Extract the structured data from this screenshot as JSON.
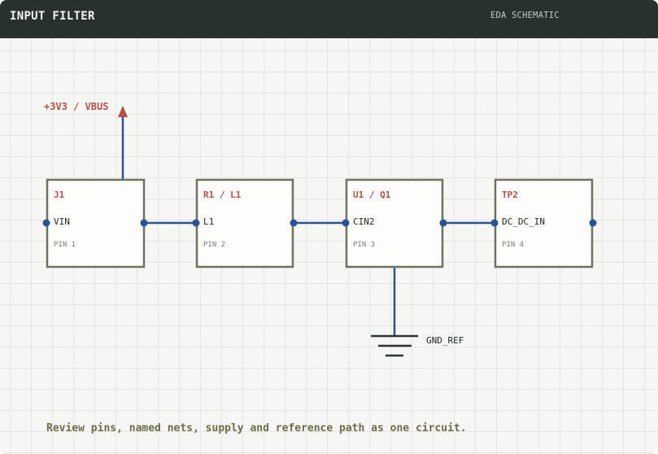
{
  "header": {
    "title": "INPUT FILTER",
    "subtitle": "EDA SCHEMATIC"
  },
  "supply": {
    "label": "+3V3 / VBUS"
  },
  "components": [
    {
      "ref": "J1",
      "net": "VIN",
      "pin": "PIN 1"
    },
    {
      "ref": "R1 / L1",
      "net": "L1",
      "pin": "PIN 2"
    },
    {
      "ref": "U1 / Q1",
      "net": "CIN2",
      "pin": "PIN 3"
    },
    {
      "ref": "TP2",
      "net": "DC_DC_IN",
      "pin": "PIN 4"
    }
  ],
  "ground": {
    "label": "GND_REF"
  },
  "footer": {
    "text": "Review pins, named nets, supply and reference path as one circuit."
  },
  "colors": {
    "wire": "#2b5293",
    "box_stroke": "#6d735d",
    "ref_text": "#b3524a",
    "titlebar": "#283130"
  }
}
